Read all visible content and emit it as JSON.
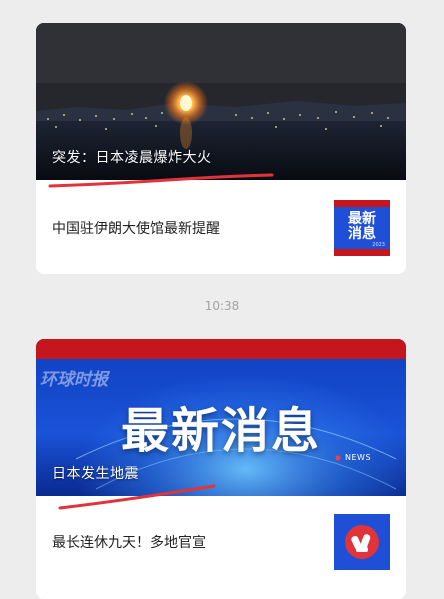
{
  "messages": [
    {
      "hero_caption": "突发：日本凌晨爆炸大火",
      "title": "中国驻伊朗大使馆最新提醒",
      "thumb_line1": "最新",
      "thumb_line2": "消息",
      "thumb_small": "2023"
    },
    {
      "hero_brand": "环球时报",
      "hero_headline": "最新消息",
      "hero_news_tag": "NEWS",
      "hero_caption": "日本发生地震",
      "title": "最长连休九天！多地官宣"
    }
  ],
  "timestamp": "10:38",
  "colors": {
    "accent_red": "#e0333a",
    "banner_red": "#c4161c",
    "news_blue": "#1f4fd6"
  }
}
